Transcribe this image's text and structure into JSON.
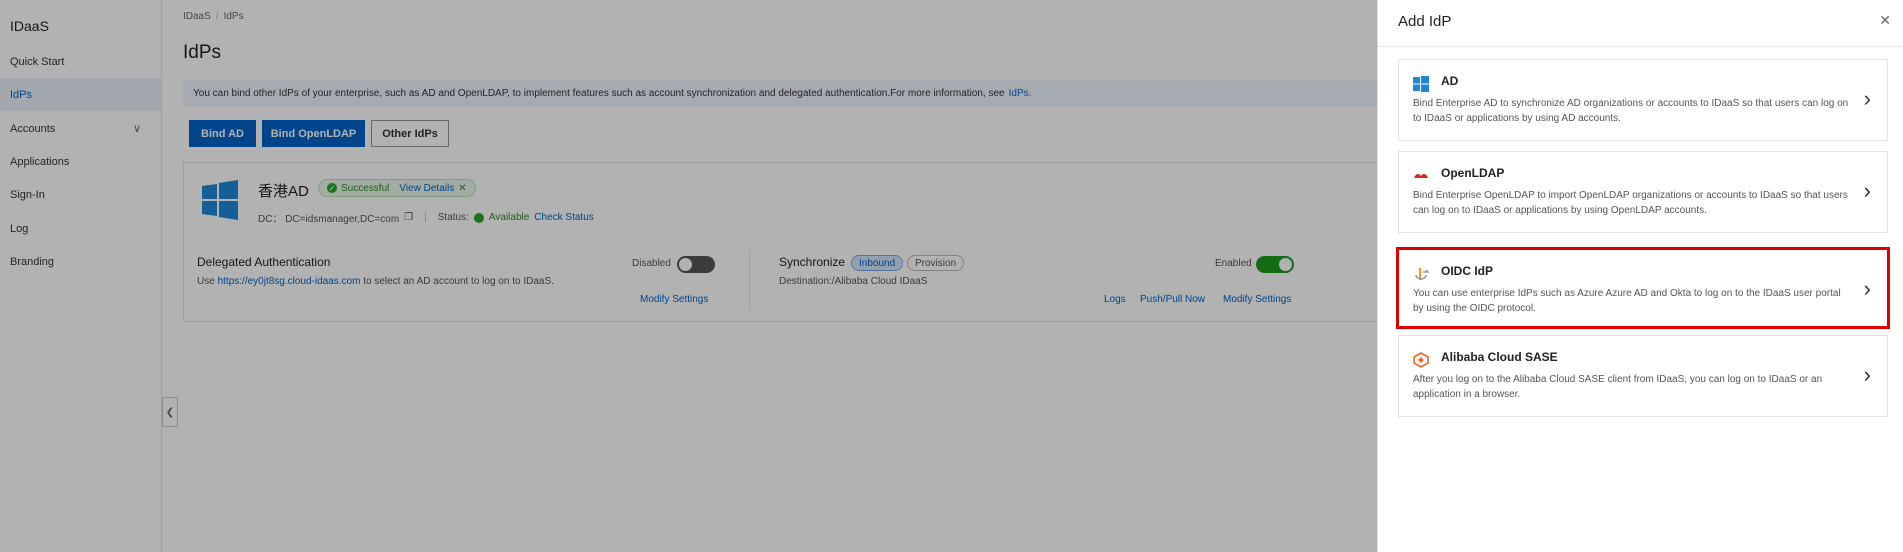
{
  "sidebar": {
    "app_title": "IDaaS",
    "items": [
      {
        "label": "Quick Start"
      },
      {
        "label": "IdPs"
      },
      {
        "label": "Accounts"
      },
      {
        "label": "Applications"
      },
      {
        "label": "Sign-In"
      },
      {
        "label": "Log"
      },
      {
        "label": "Branding"
      }
    ]
  },
  "breadcrumb": [
    "IDaaS",
    "IdPs"
  ],
  "page_title": "IdPs",
  "info_bar": {
    "text": "You can bind other IdPs of your enterprise, such as AD and OpenLDAP, to implement features such as account synchronization and delegated authentication.For more information, see",
    "link": "IdPs."
  },
  "buttons": {
    "bind_ad": "Bind AD",
    "bind_openldap": "Bind OpenLDAP",
    "other_idps": "Other IdPs"
  },
  "idp_card": {
    "name": "香港AD",
    "status": "Successful",
    "view_details": "View Details",
    "dc": "DC： DC=idsmanager,DC=com",
    "status_label": "Status:",
    "available": "Available",
    "check_status": "Check Status",
    "delegated": {
      "title": "Delegated Authentication",
      "use": "Use",
      "url": "https://ey0jt8sg.cloud-idaas.com",
      "suffix": "to select an AD account to log on to IDaaS.",
      "toggle_label": "Disabled",
      "modify": "Modify Settings"
    },
    "sync": {
      "title": "Synchronize",
      "inbound": "Inbound",
      "provision": "Provision",
      "destination": "Destination:/Alibaba Cloud IDaaS",
      "toggle_label": "Enabled",
      "logs": "Logs",
      "push_pull": "Push/Pull Now",
      "modify": "Modify Settings"
    }
  },
  "drawer": {
    "title": "Add IdP",
    "options": [
      {
        "title": "AD",
        "desc": "Bind Enterprise AD to synchronize AD organizations or accounts to IDaaS so that users can log on to IDaaS or applications by using AD accounts.",
        "icon": "windows-icon"
      },
      {
        "title": "OpenLDAP",
        "desc": "Bind Enterprise OpenLDAP to import OpenLDAP organizations or accounts to IDaaS so that users can log on to IDaaS or applications by using OpenLDAP accounts.",
        "icon": "openldap-icon"
      },
      {
        "title": "OIDC IdP",
        "desc": "You can use enterprise IdPs such as Azure Azure AD and Okta to log on to the IDaaS user portal by using the OIDC protocol.",
        "icon": "oidc-icon"
      },
      {
        "title": "Alibaba Cloud SASE",
        "desc": "After you log on to the Alibaba Cloud SASE client from IDaaS, you can log on to IDaaS or an application in a browser.",
        "icon": "sase-icon"
      }
    ]
  },
  "colors": {
    "accent": "#0064c8",
    "highlight": "#e00000",
    "success": "#2aa52a"
  }
}
